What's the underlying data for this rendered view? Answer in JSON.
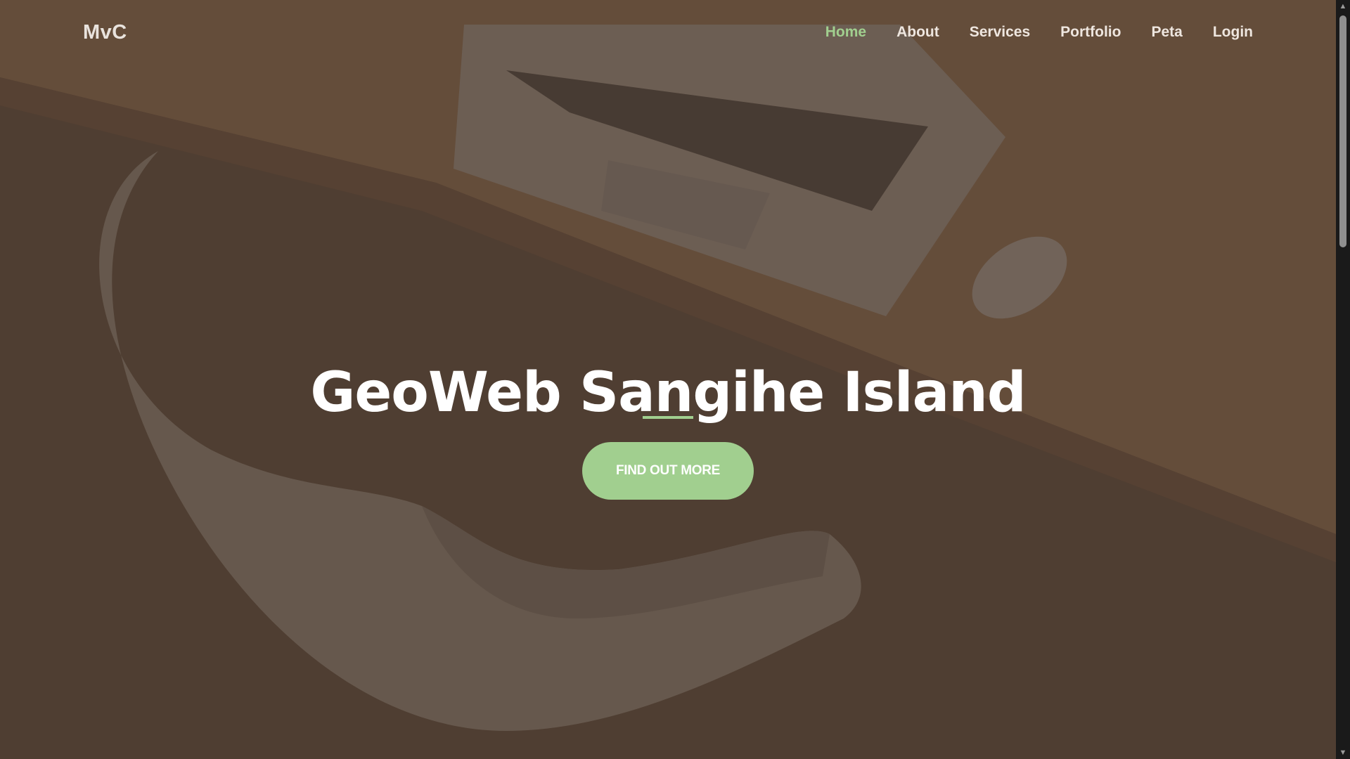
{
  "navbar": {
    "brand": "MvC",
    "items": [
      {
        "label": "Home",
        "active": true
      },
      {
        "label": "About"
      },
      {
        "label": "Services"
      },
      {
        "label": "Portfolio"
      },
      {
        "label": "Peta"
      },
      {
        "label": "Login"
      }
    ]
  },
  "hero": {
    "title": "GeoWeb Sangihe Island",
    "cta_label": "FIND OUT MORE"
  },
  "colors": {
    "accent": "#a1cf8f",
    "overlay": "#4a3d34",
    "text": "#ffffff"
  },
  "icons": {
    "scroll_up": "triangle-up-icon",
    "scroll_down": "triangle-down-icon"
  }
}
